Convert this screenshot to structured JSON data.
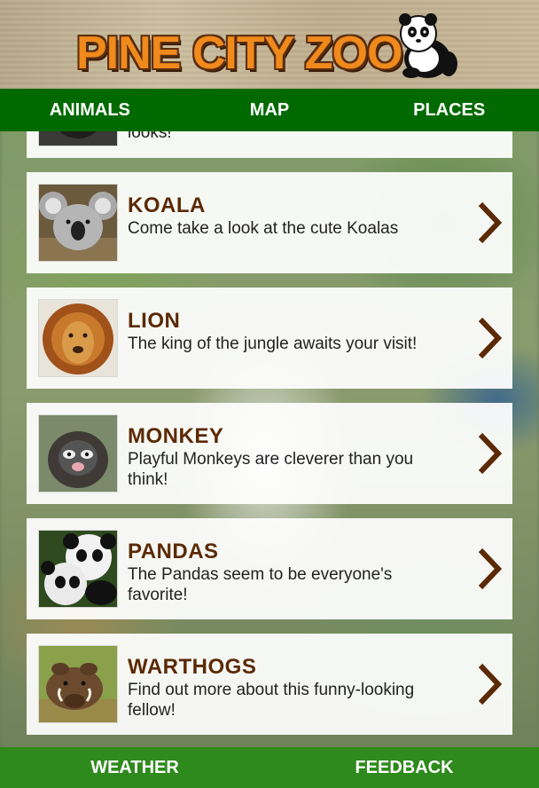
{
  "header": {
    "logo_text": "PINE CITY ZOO",
    "logo_icon": "panda-icon"
  },
  "top_nav": [
    {
      "label": "ANIMALS"
    },
    {
      "label": "MAP"
    },
    {
      "label": "PLACES"
    }
  ],
  "animals": [
    {
      "title": "",
      "description": "looks!",
      "thumb": "gorilla-photo"
    },
    {
      "title": "KOALA",
      "description": "Come take a look at the cute Koalas",
      "thumb": "koala-photo"
    },
    {
      "title": "LION",
      "description": "The king of the jungle awaits your visit!",
      "thumb": "lion-photo"
    },
    {
      "title": "MONKEY",
      "description": "Playful Monkeys are cleverer than you think!",
      "thumb": "monkey-photo"
    },
    {
      "title": "PANDAS",
      "description": "The Pandas seem to be everyone's favorite!",
      "thumb": "pandas-photo"
    },
    {
      "title": "WARTHOGS",
      "description": "Find out more about this funny-looking fellow!",
      "thumb": "warthog-photo"
    }
  ],
  "bottom_nav": [
    {
      "label": "WEATHER"
    },
    {
      "label": "FEEDBACK"
    }
  ],
  "colors": {
    "nav_green": "#006a00",
    "bottom_green": "#2e8a1c",
    "title_brown": "#5b2a05",
    "logo_orange": "#f08a1c"
  }
}
